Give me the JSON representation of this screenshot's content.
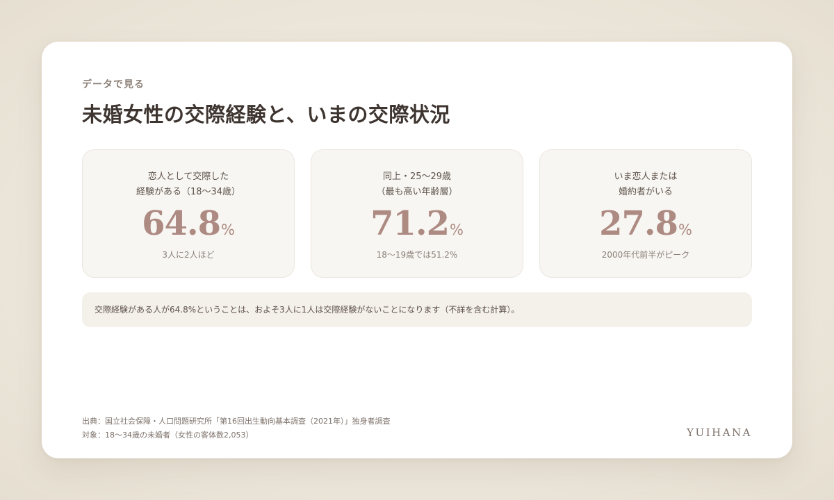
{
  "eyebrow": "データで見る",
  "title": "未婚女性の交際経験と、いまの交際状況",
  "stats": [
    {
      "label": "恋人として交際した\n経験がある（18〜34歳）",
      "value": "64.8",
      "unit": "%",
      "note": "3人に2人ほど"
    },
    {
      "label": "同上・25〜29歳\n（最も高い年齢層）",
      "value": "71.2",
      "unit": "%",
      "note": "18〜19歳では51.2%"
    },
    {
      "label": "いま恋人または\n婚約者がいる",
      "value": "27.8",
      "unit": "%",
      "note": "2000年代前半がピーク"
    }
  ],
  "note": "交際経験がある人が64.8%ということは、およそ3人に1人は交際経験がないことになります（不詳を含む計算）。",
  "source": {
    "line1": "出典：国立社会保障・人口問題研究所「第16回出生動向基本調査（2021年）」独身者調査",
    "line2": "対象：18〜34歳の未婚者（女性の客体数2,053）"
  },
  "brand": "YUIHANA",
  "colors": {
    "accent": "#ad8a82",
    "background": "#ece6da",
    "card": "#ffffff",
    "stat_bg": "#f8f6f2",
    "note_bg": "#f4f0ea",
    "text": "#3e3530"
  }
}
